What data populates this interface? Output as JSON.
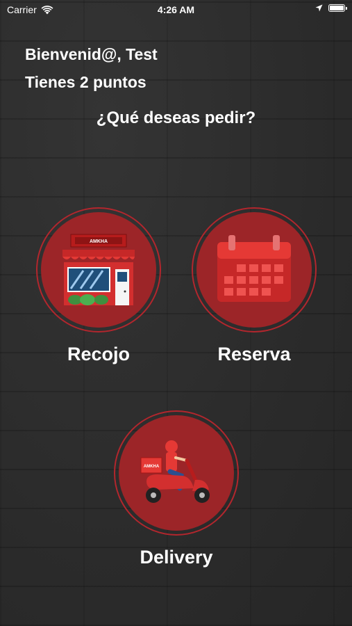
{
  "status_bar": {
    "carrier": "Carrier",
    "time": "4:26 AM",
    "battery_level": 1.0
  },
  "greeting": {
    "welcome": "Bienvenid@, Test",
    "points": "Tienes 2 puntos"
  },
  "question": "¿Qué deseas pedir?",
  "options": {
    "recojo": {
      "label": "Recojo",
      "icon": "storefront-icon",
      "sign_text": "AMKHA"
    },
    "reserva": {
      "label": "Reserva",
      "icon": "calendar-icon"
    },
    "delivery": {
      "label": "Delivery",
      "icon": "delivery-scooter-icon",
      "box_text": "AMKHA"
    }
  },
  "colors": {
    "accent": "#b3262d",
    "circle_fill": "#9c2528",
    "text": "#ffffff",
    "background": "#2d2d2d"
  }
}
